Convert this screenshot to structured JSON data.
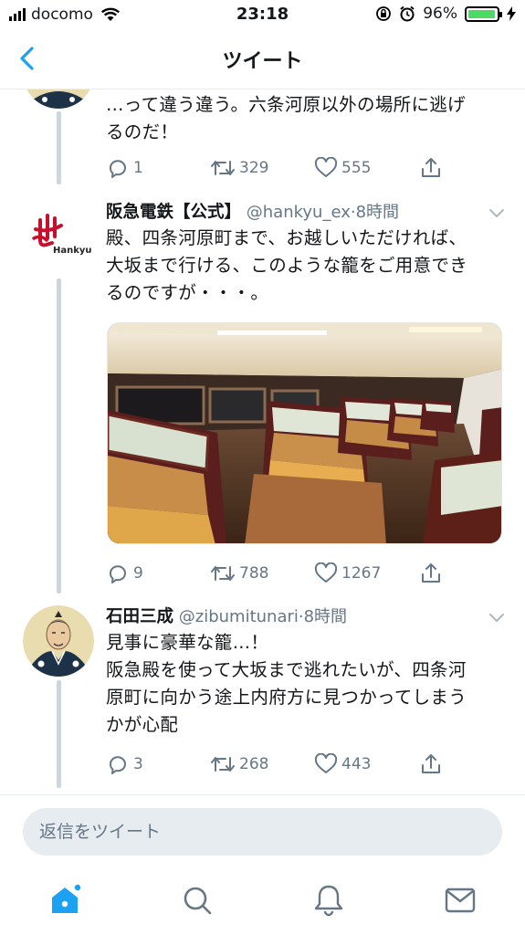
{
  "status_bar": {
    "carrier": "docomo",
    "time": "23:18",
    "battery_percent": "96%",
    "battery_level": 0.96,
    "battery_color": "#4cd964"
  },
  "nav": {
    "title": "ツイート",
    "back_icon": "chevron-left-icon"
  },
  "colors": {
    "accent": "#1da1f2",
    "secondary_text": "#657786",
    "thread_line": "#ccd6dd"
  },
  "tweets": [
    {
      "text": "…って違う違う。六条河原以外の場所に逃げ\nるのだ！",
      "reply_count": "1",
      "retweet_count": "329",
      "like_count": "555"
    },
    {
      "name": "阪急電鉄【公式】",
      "handle": "@hankyu_ex",
      "separator": "·",
      "time": "8時間",
      "avatar_logo_text": "Hankyu",
      "text": "殿、四条河原町まで、お越しいただければ、\n大坂まで行ける、このような籠をご用意でき\nるのですが・・・。",
      "reply_count": "9",
      "retweet_count": "788",
      "like_count": "1267"
    },
    {
      "name": "石田三成",
      "handle": "@zibumitunari",
      "separator": "·",
      "time": "8時間",
      "text": "見事に豪華な籠…！\n阪急殿を使って大坂まで逃れたいが、四条河\n原町に向かう途上内府方に見つかってしまう\nかが心配",
      "reply_count": "3",
      "retweet_count": "268",
      "like_count": "443"
    }
  ],
  "reply_bar": {
    "placeholder": "返信をツイート"
  },
  "tabbar": {
    "items": [
      "home-icon",
      "search-icon",
      "notifications-icon",
      "messages-icon"
    ]
  }
}
